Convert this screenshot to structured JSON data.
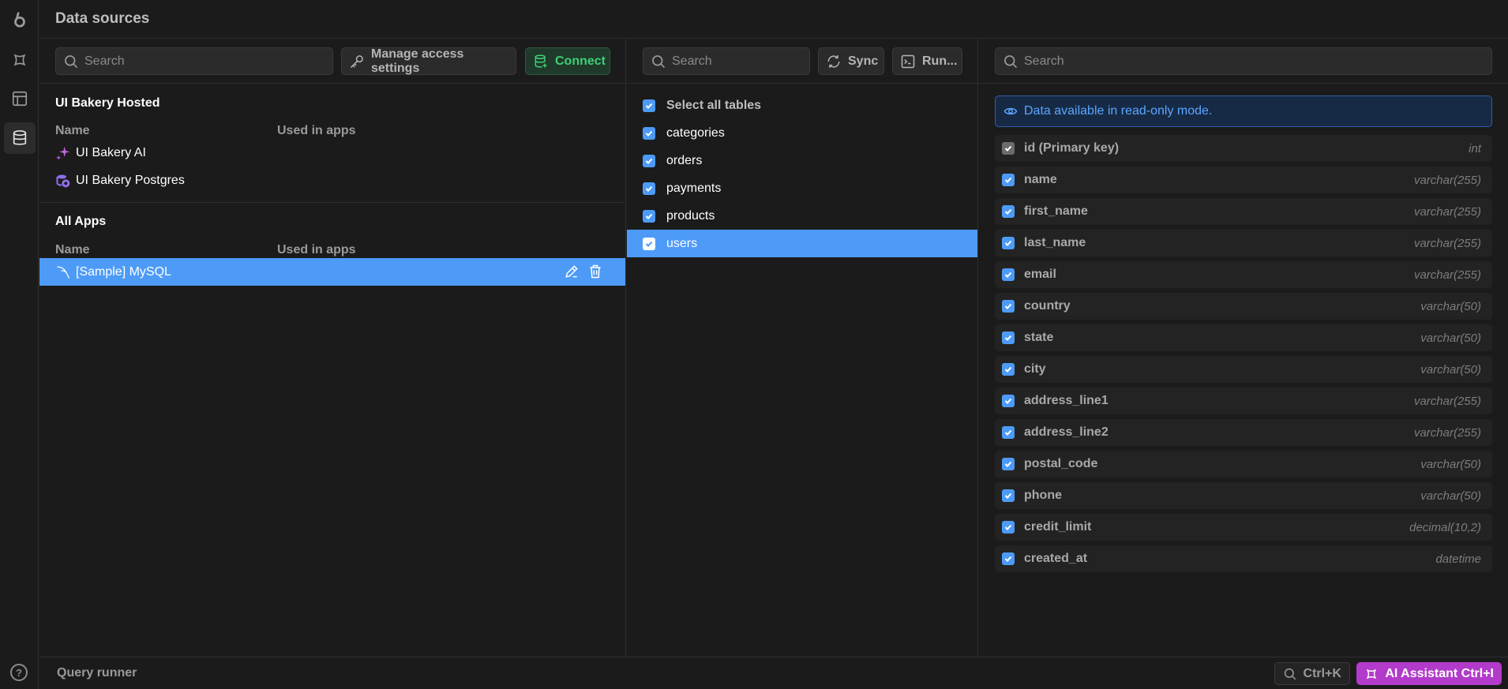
{
  "header": {
    "title": "Data sources"
  },
  "rail": {
    "items": [
      {
        "icon": "logo-icon"
      },
      {
        "icon": "ai-assistant-icon"
      },
      {
        "icon": "table-icon"
      },
      {
        "icon": "database-icon",
        "active": true
      }
    ],
    "help_label": "?"
  },
  "left": {
    "search_placeholder": "Search",
    "manage_access_label": "Manage access settings",
    "connect_label": "Connect",
    "hosted": {
      "title": "UI Bakery Hosted",
      "col_name": "Name",
      "col_used": "Used in apps",
      "items": [
        {
          "name": "UI Bakery AI",
          "icon": "sparkle-icon"
        },
        {
          "name": "UI Bakery Postgres",
          "icon": "postgres-icon"
        }
      ]
    },
    "all_apps": {
      "title": "All Apps",
      "col_name": "Name",
      "col_used": "Used in apps",
      "items": [
        {
          "name": "[Sample] MySQL",
          "icon": "mysql-icon",
          "selected": true
        }
      ]
    }
  },
  "middle": {
    "search_placeholder": "Search",
    "sync_label": "Sync",
    "run_label": "Run...",
    "select_all_label": "Select all tables",
    "tables": [
      {
        "name": "categories",
        "checked": true
      },
      {
        "name": "orders",
        "checked": true
      },
      {
        "name": "payments",
        "checked": true
      },
      {
        "name": "products",
        "checked": true
      },
      {
        "name": "users",
        "checked": true,
        "selected": true
      }
    ]
  },
  "right": {
    "search_placeholder": "Search",
    "notice": "Data available in read-only mode.",
    "fields": [
      {
        "name": "id (Primary key)",
        "type": "int",
        "primary": true
      },
      {
        "name": "name",
        "type": "varchar(255)"
      },
      {
        "name": "first_name",
        "type": "varchar(255)"
      },
      {
        "name": "last_name",
        "type": "varchar(255)"
      },
      {
        "name": "email",
        "type": "varchar(255)"
      },
      {
        "name": "country",
        "type": "varchar(50)"
      },
      {
        "name": "state",
        "type": "varchar(50)"
      },
      {
        "name": "city",
        "type": "varchar(50)"
      },
      {
        "name": "address_line1",
        "type": "varchar(255)"
      },
      {
        "name": "address_line2",
        "type": "varchar(255)"
      },
      {
        "name": "postal_code",
        "type": "varchar(50)"
      },
      {
        "name": "phone",
        "type": "varchar(50)"
      },
      {
        "name": "credit_limit",
        "type": "decimal(10,2)"
      },
      {
        "name": "created_at",
        "type": "datetime"
      }
    ]
  },
  "footer": {
    "query_runner": "Query runner",
    "shortcut": "Ctrl+K",
    "ai_assistant": "AI Assistant Ctrl+I"
  },
  "colors": {
    "accent": "#4d9bf7",
    "connect_green": "#3fcf79",
    "ai_purple": "#b23bcb",
    "notice_blue": "#5aa6ff"
  }
}
